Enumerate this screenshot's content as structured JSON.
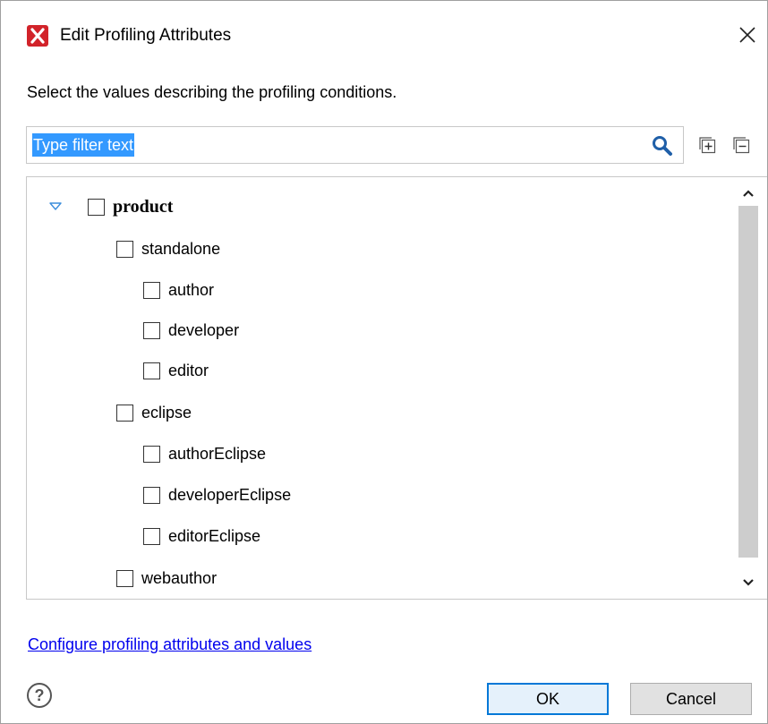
{
  "window": {
    "title": "Edit Profiling Attributes",
    "app_icon": "oxygen-x-icon",
    "close_icon": "close-icon"
  },
  "instructions": "Select the values describing the profiling conditions.",
  "filter": {
    "value": "",
    "placeholder": "Type filter text",
    "selected_text": "Type filter text",
    "search_icon": "search-icon",
    "expand_all_icon": "expand-all-icon",
    "collapse_all_icon": "collapse-all-icon"
  },
  "tree": {
    "root": {
      "label": "product",
      "expanded": true,
      "checked": false
    },
    "items": [
      {
        "label": "standalone",
        "level": 1,
        "checked": false
      },
      {
        "label": "author",
        "level": 2,
        "checked": false
      },
      {
        "label": "developer",
        "level": 2,
        "checked": false
      },
      {
        "label": "editor",
        "level": 2,
        "checked": false
      },
      {
        "label": "eclipse",
        "level": 1,
        "checked": false
      },
      {
        "label": "authorEclipse",
        "level": 2,
        "checked": false
      },
      {
        "label": "developerEclipse",
        "level": 2,
        "checked": false
      },
      {
        "label": "editorEclipse",
        "level": 2,
        "checked": false
      },
      {
        "label": "webauthor",
        "level": 1,
        "checked": false
      }
    ]
  },
  "footer": {
    "configure_link": "Configure profiling attributes and values",
    "help_icon": "help-icon",
    "ok_label": "OK",
    "cancel_label": "Cancel"
  },
  "colors": {
    "selection": "#3399ff",
    "link": "#0000ee",
    "default_button_border": "#0078d7",
    "app_icon_red": "#d2232a",
    "expander": "#3c8ddc"
  }
}
